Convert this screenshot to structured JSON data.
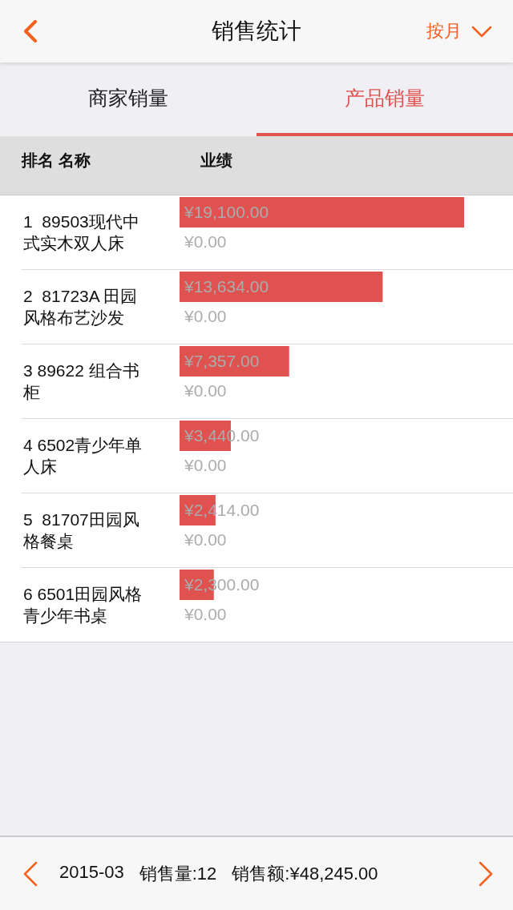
{
  "header": {
    "title": "销售统计",
    "filter": "按月"
  },
  "tabs": [
    {
      "label": "商家销量",
      "selected": false
    },
    {
      "label": "产品销量",
      "selected": true
    }
  ],
  "table": {
    "columns": [
      "排名 名称",
      "业绩"
    ],
    "chart_data": {
      "type": "bar",
      "orientation": "horizontal",
      "categories": [
        "1  89503现代中式实木双人床",
        "2  81723A 田园风格布艺沙发",
        "3 89622 组合书柜",
        "4 6502青少年单人床",
        "5  81707田园风格餐桌",
        "6 6501田园风格青少年书桌"
      ],
      "values": [
        19100,
        13634,
        7357,
        3440,
        2414,
        2300
      ],
      "value_labels": [
        "¥19,100.00",
        "¥13,634.00",
        "¥7,357.00",
        "¥3,440.00",
        "¥2,414.00",
        "¥2,300.00"
      ]
    },
    "rows": [
      {
        "sales_secondary": "¥0.00"
      },
      {
        "sales_secondary": "¥0.00"
      },
      {
        "sales_secondary": "¥0.00"
      },
      {
        "sales_secondary": "¥0.00"
      },
      {
        "sales_secondary": "¥0.00"
      },
      {
        "sales_secondary": "¥0.00"
      }
    ]
  },
  "footer": {
    "month": "2015-03",
    "quantity": "销售量:12",
    "total": "销售额:¥48,245.00"
  }
}
